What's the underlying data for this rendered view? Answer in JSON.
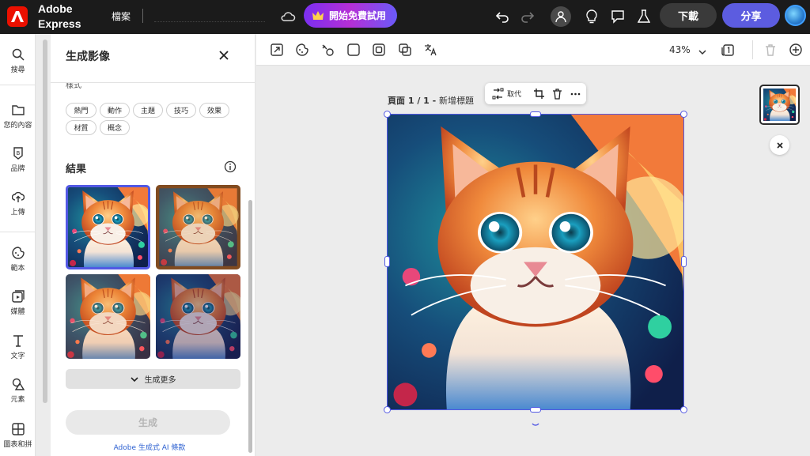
{
  "topbar": {
    "brand_line1": "Adobe",
    "brand_line2": "Express",
    "file_menu": "檔案",
    "trial_label": "開始免費試用",
    "download_label": "下載",
    "share_label": "分享"
  },
  "rail": {
    "items": [
      {
        "label": "搜尋",
        "icon": "search-icon"
      },
      {
        "label": "您的內容",
        "icon": "folder-icon"
      },
      {
        "label": "品牌",
        "icon": "brand-icon"
      },
      {
        "label": "上傳",
        "icon": "upload-icon"
      },
      {
        "label": "範本",
        "icon": "template-icon"
      },
      {
        "label": "媒體",
        "icon": "media-icon"
      },
      {
        "label": "文字",
        "icon": "text-icon"
      },
      {
        "label": "元素",
        "icon": "shapes-icon"
      },
      {
        "label": "圖表和拼",
        "icon": "grid-icon"
      }
    ]
  },
  "panel": {
    "title": "生成影像",
    "style_label": "樣式",
    "style_chips": [
      "熱門",
      "動作",
      "主題",
      "技巧",
      "效果",
      "材質",
      "概念"
    ],
    "results_label": "結果",
    "more_label": "生成更多",
    "generate_label": "生成",
    "terms_link": "Adobe 生成式 AI 條款"
  },
  "toolbar2": {
    "zoom": "43%"
  },
  "canvas": {
    "page_prefix": "頁面 1 / 1 - ",
    "page_title": "新增標題",
    "replace_label": "取代"
  },
  "colors": {
    "accent": "#5258e4",
    "topbar": "#1b1b1b",
    "share": "#5c5ce0",
    "adobe_red": "#eb1000"
  }
}
